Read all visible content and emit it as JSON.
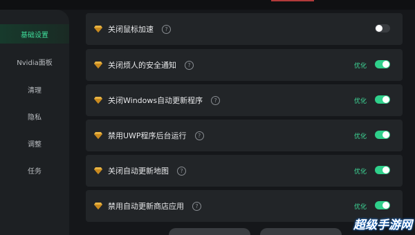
{
  "sidebar": {
    "items": [
      {
        "label": "基础设置",
        "active": true
      },
      {
        "label": "Nvidia面板",
        "active": false
      },
      {
        "label": "清理",
        "active": false
      },
      {
        "label": "隐私",
        "active": false
      },
      {
        "label": "调整",
        "active": false
      },
      {
        "label": "任务",
        "active": false
      }
    ]
  },
  "settings": [
    {
      "label": "关闭鼠标加速",
      "status": "",
      "enabled": false
    },
    {
      "label": "关闭烦人的安全通知",
      "status": "优化",
      "enabled": true
    },
    {
      "label": "关闭Windows自动更新程序",
      "status": "优化",
      "enabled": true
    },
    {
      "label": "禁用UWP程序后台运行",
      "status": "优化",
      "enabled": true
    },
    {
      "label": "关闭自动更新地图",
      "status": "优化",
      "enabled": true
    },
    {
      "label": "禁用自动更新商店应用",
      "status": "优化",
      "enabled": true
    }
  ],
  "help_glyph": "?",
  "watermark": "超级手游网",
  "colors": {
    "accent": "#2fd08b",
    "gem": "#e8b341"
  }
}
